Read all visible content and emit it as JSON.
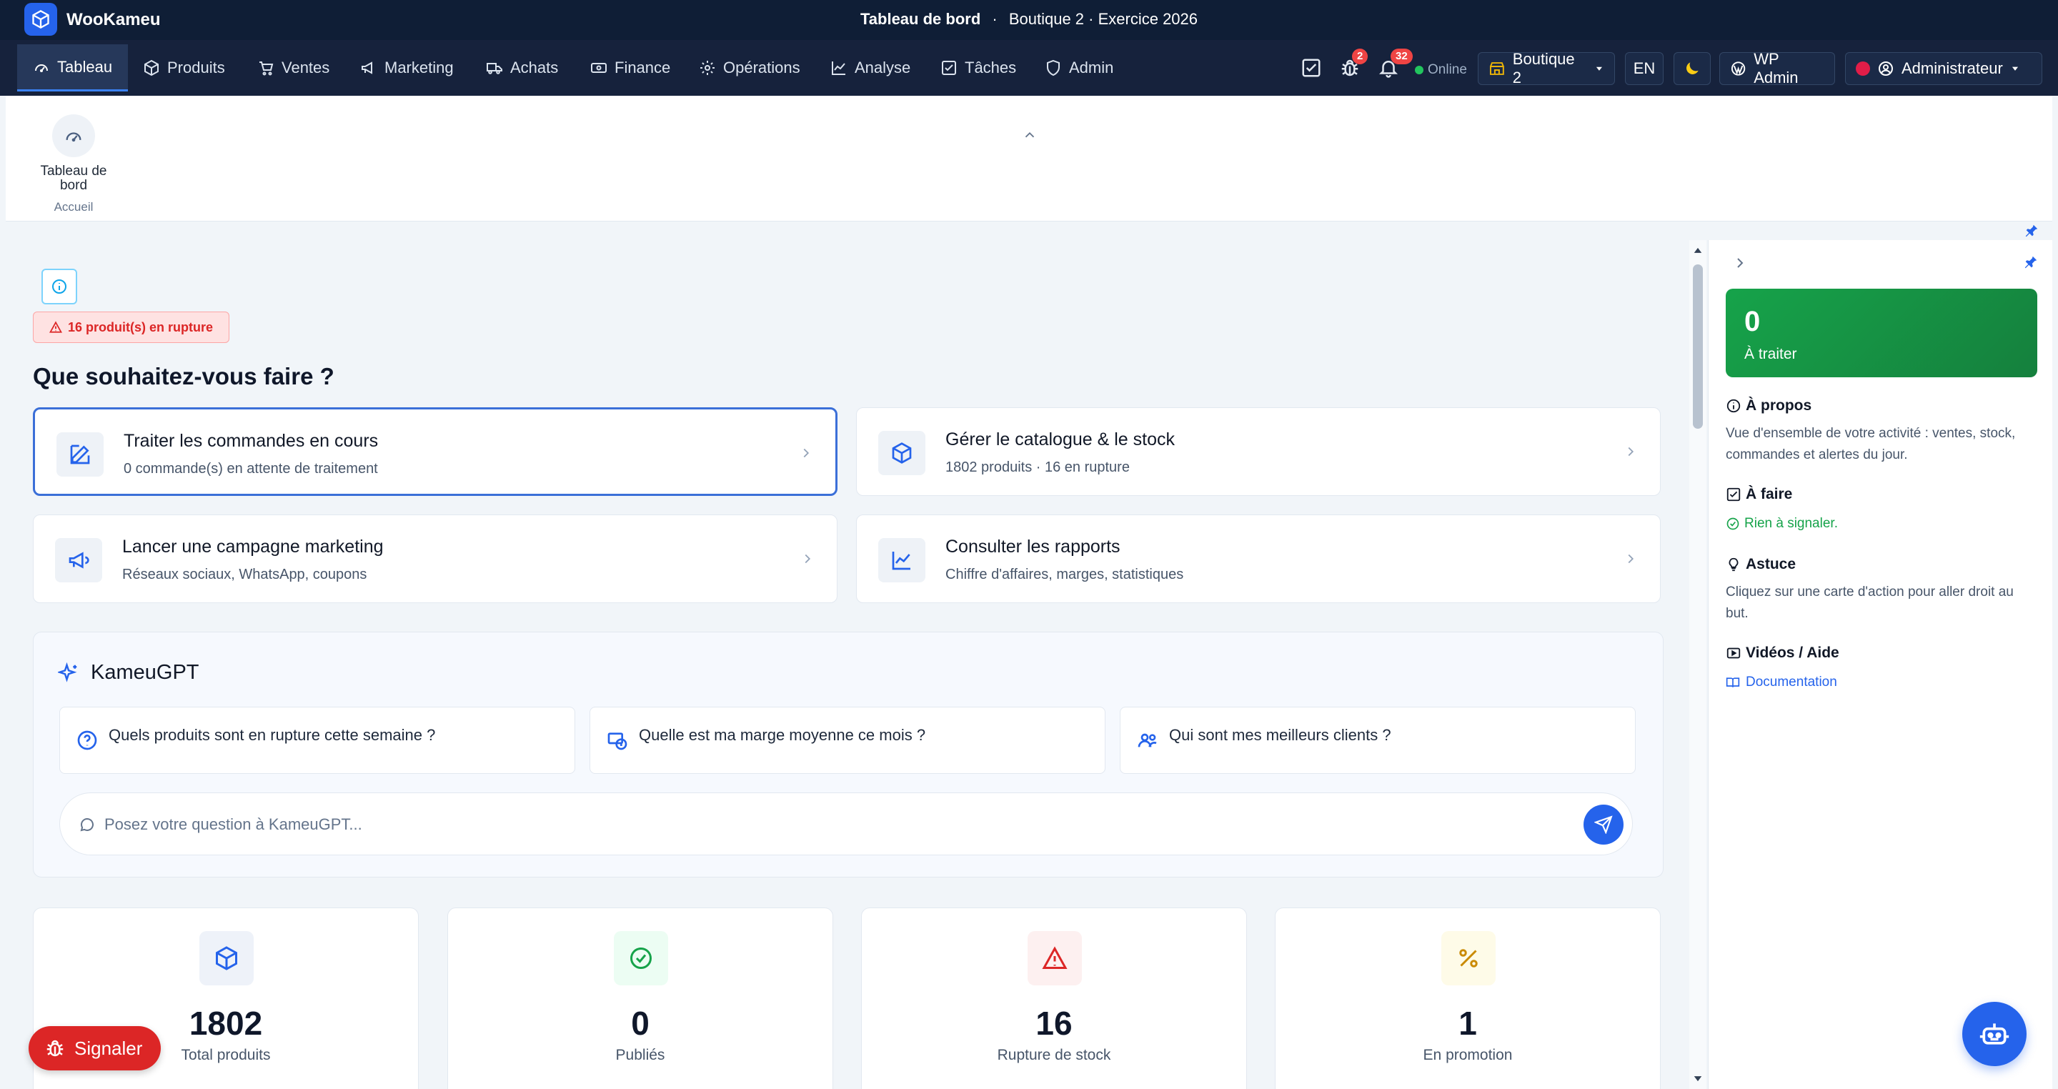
{
  "app": {
    "name": "WooKameu"
  },
  "title": {
    "page": "Tableau de bord",
    "sep": "·",
    "context": "Boutique 2 · Exercice 2026"
  },
  "nav": {
    "items": [
      {
        "label": "Tableau",
        "icon": "gauge-icon"
      },
      {
        "label": "Produits",
        "icon": "box-icon"
      },
      {
        "label": "Ventes",
        "icon": "cart-icon"
      },
      {
        "label": "Marketing",
        "icon": "megaphone-icon"
      },
      {
        "label": "Achats",
        "icon": "truck-icon"
      },
      {
        "label": "Finance",
        "icon": "banknote-icon"
      },
      {
        "label": "Opérations",
        "icon": "gear-icon"
      },
      {
        "label": "Analyse",
        "icon": "chart-line-icon"
      },
      {
        "label": "Tâches",
        "icon": "checkbox-icon"
      },
      {
        "label": "Admin",
        "icon": "shield-icon"
      }
    ],
    "bug_badge": "2",
    "notif_badge": "32",
    "status": "Online",
    "shop": "Boutique 2",
    "lang": "EN",
    "wp_admin": "WP Admin",
    "user": "Administrateur"
  },
  "ribbon": {
    "label": "Tableau de bord",
    "sub": "Accueil"
  },
  "alert": {
    "text": "16 produit(s) en rupture"
  },
  "main": {
    "heading": "Que souhaitez-vous faire ?",
    "actions": [
      {
        "title": "Traiter les commandes en cours",
        "sub": "0 commande(s) en attente de traitement",
        "icon": "edit-icon"
      },
      {
        "title": "Gérer le catalogue & le stock",
        "sub": "1802 produits · 16 en rupture",
        "icon": "box-icon"
      },
      {
        "title": "Lancer une campagne marketing",
        "sub": "Réseaux sociaux, WhatsApp, coupons",
        "icon": "megaphone-icon"
      },
      {
        "title": "Consulter les rapports",
        "sub": "Chiffre d'affaires, marges, statistiques",
        "icon": "chart-line-icon"
      }
    ]
  },
  "gpt": {
    "title": "KameuGPT",
    "suggestions": [
      "Quels produits sont en rupture cette semaine ?",
      "Quelle est ma marge moyenne ce mois ?",
      "Qui sont mes meilleurs clients ?"
    ],
    "placeholder": "Posez votre question à KameuGPT..."
  },
  "stats": [
    {
      "value": "1802",
      "label": "Total produits",
      "color": "#2563eb"
    },
    {
      "value": "0",
      "label": "Publiés",
      "color": "#16a34a"
    },
    {
      "value": "16",
      "label": "Rupture de stock",
      "color": "#dc2626"
    },
    {
      "value": "1",
      "label": "En promotion",
      "color": "#ca8a04"
    }
  ],
  "panel": {
    "todo_count": "0",
    "todo_label": "À traiter",
    "about_title": "À propos",
    "about_text": "Vue d'ensemble de votre activité : ventes, stock, commandes et alertes du jour.",
    "todo_title": "À faire",
    "todo_text": "Rien à signaler.",
    "tip_title": "Astuce",
    "tip_text": "Cliquez sur une carte d'action pour aller droit au but.",
    "videos_title": "Vidéos / Aide",
    "doc_link": "Documentation"
  },
  "signaler": "Signaler",
  "colors": {
    "nav_bg": "#16223c",
    "title_bg": "#0f1e36",
    "accent": "#2563eb",
    "success": "#16a34a",
    "danger": "#dc2626"
  }
}
